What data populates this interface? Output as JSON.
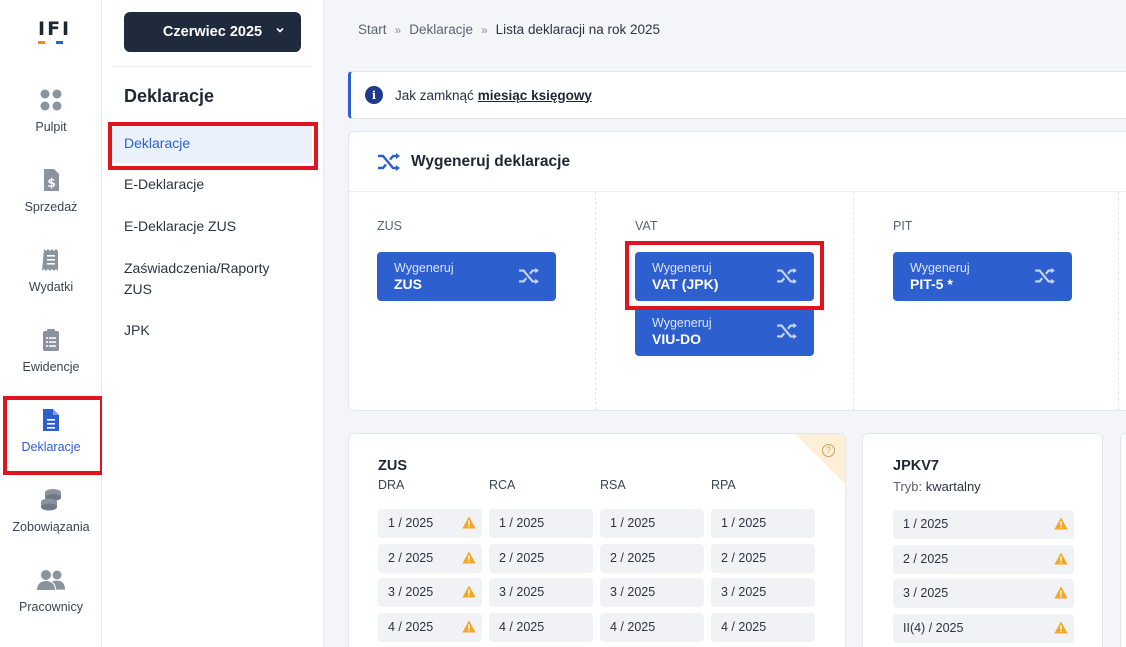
{
  "app": {
    "logo_text": "IFI"
  },
  "rail": [
    {
      "label": "Pulpit",
      "icon": "dashboard-icon"
    },
    {
      "label": "Sprzedaż",
      "icon": "invoice-dollar-icon"
    },
    {
      "label": "Wydatki",
      "icon": "receipt-icon"
    },
    {
      "label": "Ewidencje",
      "icon": "clipboard-list-icon"
    },
    {
      "label": "Deklaracje",
      "icon": "document-icon"
    },
    {
      "label": "Zobowiązania",
      "icon": "coins-icon"
    },
    {
      "label": "Pracownicy",
      "icon": "users-icon"
    }
  ],
  "period_selector": {
    "label": "Czerwiec 2025"
  },
  "subnav": {
    "title": "Deklaracje",
    "items": [
      "Deklaracje",
      "E-Deklaracje",
      "E-Deklaracje ZUS",
      "Zaświadczenia/Raporty",
      "ZUS",
      "JPK"
    ]
  },
  "breadcrumb": {
    "items": [
      "Start",
      "Deklaracje",
      "Lista deklaracji na rok 2025"
    ],
    "separator": "»"
  },
  "info": {
    "text": "Jak zamknąć",
    "link": "miesiąc księgowy",
    "icon_glyph": "i"
  },
  "generate": {
    "title": "Wygeneruj deklaracje",
    "columns": [
      {
        "label": "ZUS",
        "buttons": [
          {
            "line1": "Wygeneruj",
            "line2": "ZUS"
          }
        ]
      },
      {
        "label": "VAT",
        "buttons": [
          {
            "line1": "Wygeneruj",
            "line2": "VAT (JPK)"
          },
          {
            "line1": "Wygeneruj",
            "line2": "VIU-DO"
          }
        ]
      },
      {
        "label": "PIT",
        "buttons": [
          {
            "line1": "Wygeneruj",
            "line2": "PIT-5 *"
          }
        ]
      }
    ]
  },
  "zus_card": {
    "title": "ZUS",
    "help_glyph": "?",
    "columns": [
      "DRA",
      "RCA",
      "RSA",
      "RPA"
    ],
    "rows": [
      [
        "1 / 2025",
        "1 / 2025",
        "1 / 2025",
        "1 / 2025"
      ],
      [
        "2 / 2025",
        "2 / 2025",
        "2 / 2025",
        "2 / 2025"
      ],
      [
        "3 / 2025",
        "3 / 2025",
        "3 / 2025",
        "3 / 2025"
      ],
      [
        "4 / 2025",
        "4 / 2025",
        "4 / 2025",
        "4 / 2025"
      ]
    ],
    "warn_column": 0
  },
  "jpk_card": {
    "title": "JPKV7",
    "mode_label": "Tryb:",
    "mode_value": "kwartalny",
    "rows": [
      "1 / 2025",
      "2 / 2025",
      "3 / 2025",
      "II(4) / 2025"
    ]
  },
  "colors": {
    "accent": "#2d5fcf",
    "highlight_box": "#e0141e",
    "warning": "#f5a623",
    "dark": "#1f2a3c"
  }
}
